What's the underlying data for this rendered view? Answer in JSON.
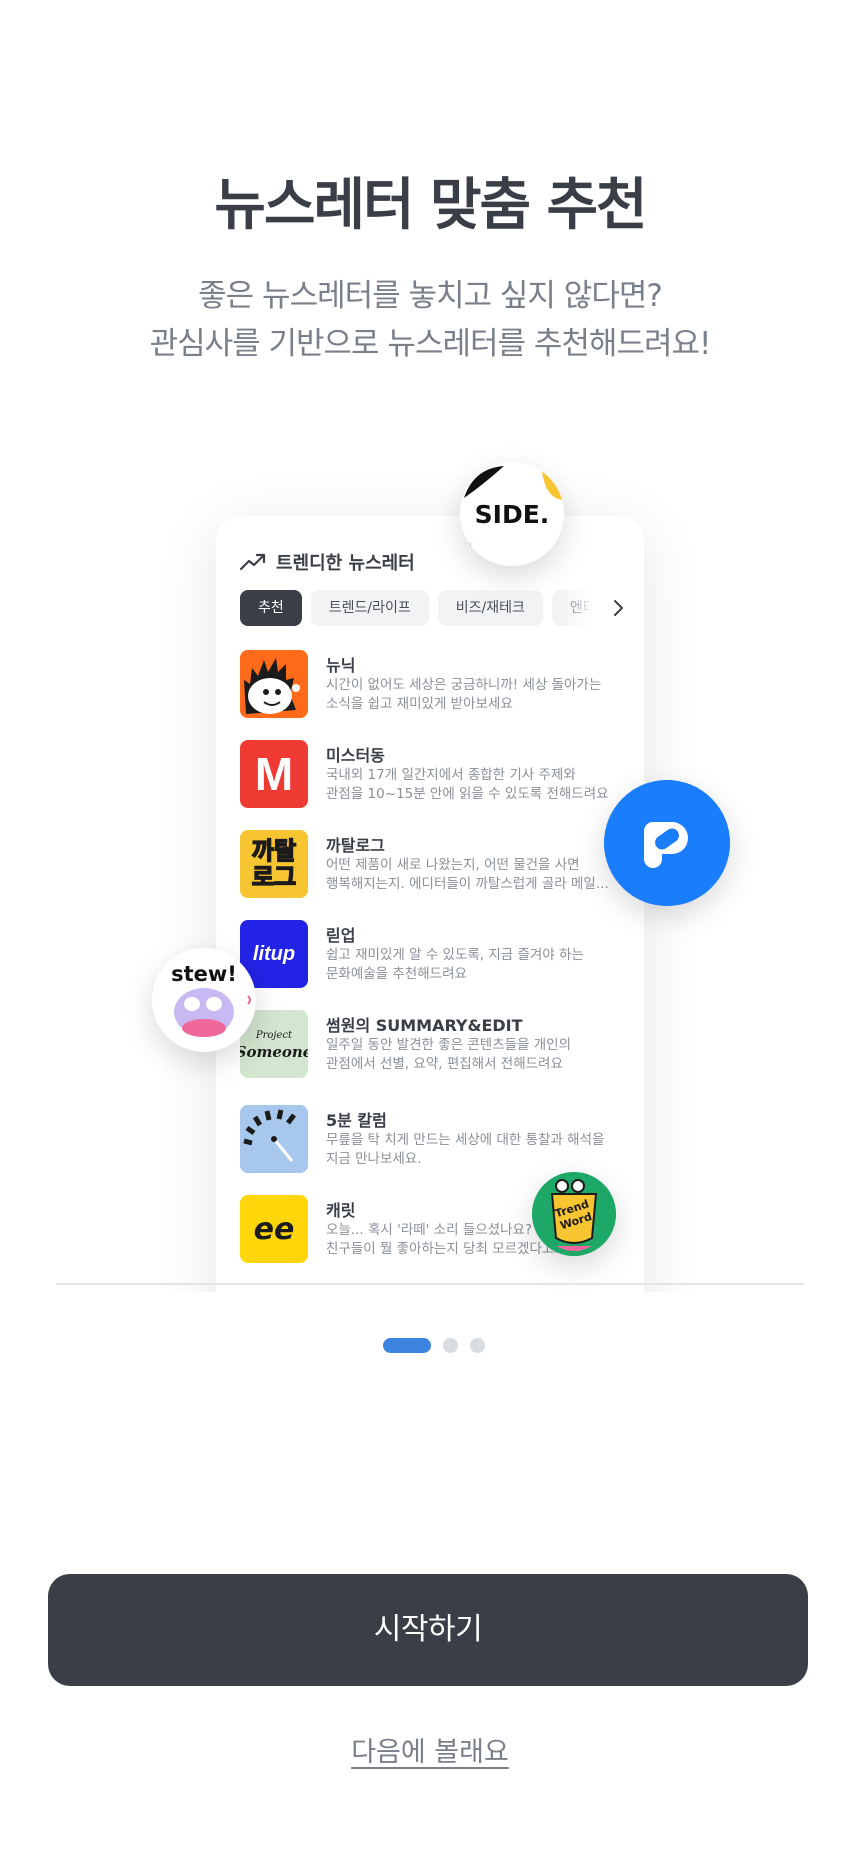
{
  "page": {
    "title": "뉴스레터 맞춤 추천",
    "subtitle_line1": "좋은 뉴스레터를 놓치고 싶지 않다면?",
    "subtitle_line2": "관심사를 기반으로 뉴스레터를 추천해드려요!"
  },
  "preview": {
    "header_icon": "trending-up-icon",
    "header_title": "트렌디한 뉴스레터",
    "chips": [
      {
        "label": "추천",
        "active": true
      },
      {
        "label": "트렌드/라이프",
        "active": false
      },
      {
        "label": "비즈/재테크",
        "active": false
      },
      {
        "label": "엔터",
        "active": false
      }
    ],
    "items": [
      {
        "name": "뉴닉",
        "desc1": "시간이 없어도 세상은 궁금하니까! 세상 돌아가는",
        "desc2": "소식을 쉽고 재미있게 받아보세요"
      },
      {
        "name": "미스터동",
        "desc1": "국내외 17개 일간지에서 종합한 기사 주제와",
        "desc2": "관점을 10~15분 안에 읽을 수 있도록 전해드려요"
      },
      {
        "name": "까탈로그",
        "desc1": "어떤 제품이 새로 나왔는지, 어떤 물건을 사면",
        "desc2": "행복해지는지. 에디터들이 까탈스럽게 골라 메일..."
      },
      {
        "name": "릳업",
        "desc1": "쉽고 재미있게 알 수 있도록, 지금 즐겨야 하는",
        "desc2": "문화예술을 추천해드려요"
      },
      {
        "name": "썸원의 SUMMARY&EDIT",
        "desc1": "일주일 동안 발견한 좋은 콘텐츠들을 개인의",
        "desc2": "관점에서 선별, 요약, 편집해서 전해드려요"
      },
      {
        "name": "5분 칼럼",
        "desc1": "무릎을 탁 치게 만드는 세상에 대한 통찰과 해석을",
        "desc2": "지금 만나보세요."
      },
      {
        "name": "캐릿",
        "desc1": "오늘... 혹시 '라떼' 소리 들으셨나요?",
        "desc2": "친구들이 뭘 좋아하는지 당최 모르겠다고요?"
      }
    ],
    "thumb_text": {
      "mrdong": "M",
      "catalog1": "까탈",
      "catalog2": "로그",
      "litup": "litup",
      "someone1": "Project",
      "someone2": "Someone",
      "careet": "ee"
    },
    "badges": {
      "side": "SIDE.",
      "stew": "stew!",
      "trendword1": "Trend",
      "trendword2": "Word"
    }
  },
  "pager": {
    "count": 3,
    "active_index": 0
  },
  "actions": {
    "start_label": "시작하기",
    "later_label": "다음에 볼래요"
  },
  "colors": {
    "primary_dark": "#3a3f47",
    "accent_blue": "#3c84e0",
    "pandora_blue": "#1a7dfb",
    "mrdong_red": "#ef3a33",
    "litup_blue": "#2323e6",
    "careet_yellow": "#ffd60a"
  }
}
